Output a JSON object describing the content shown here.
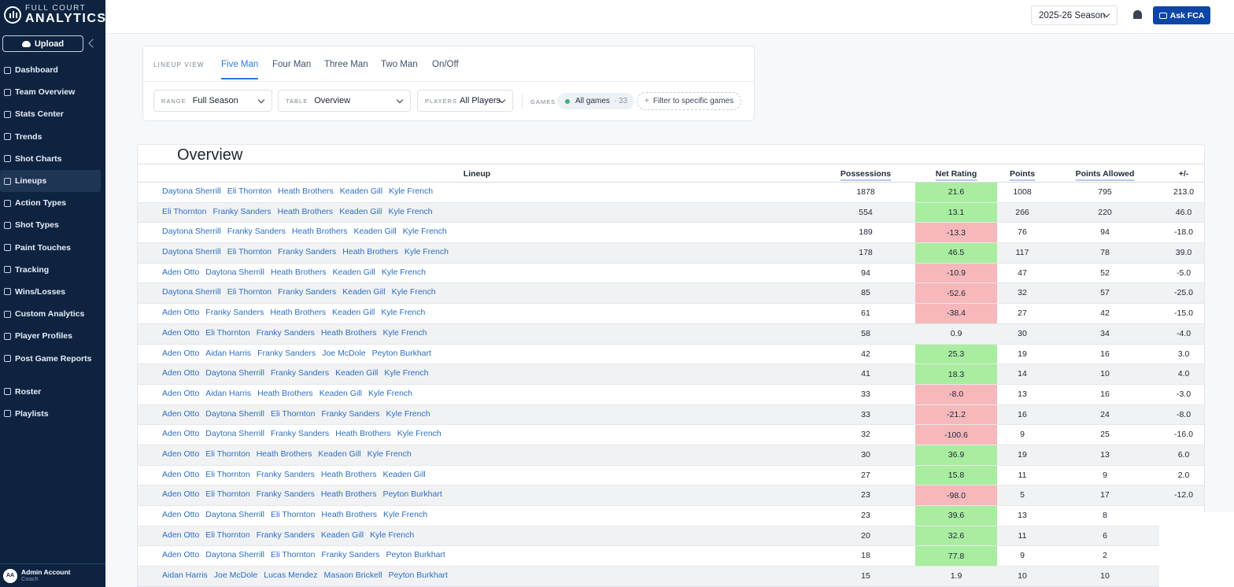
{
  "brand": {
    "top": "FULL COURT",
    "bottom": "ANALYTICS"
  },
  "sidebar": {
    "upload_label": "Upload",
    "items": [
      {
        "label": "Dashboard",
        "icon": "dashboard-icon"
      },
      {
        "label": "Team Overview",
        "icon": "team-icon"
      },
      {
        "label": "Stats Center",
        "icon": "stats-icon"
      },
      {
        "label": "Trends",
        "icon": "trend-icon"
      },
      {
        "label": "Shot Charts",
        "icon": "target-icon"
      },
      {
        "label": "Lineups",
        "icon": "table-icon",
        "active": true
      },
      {
        "label": "Action Types",
        "icon": "run-icon"
      },
      {
        "label": "Shot Types",
        "icon": "basketball-icon"
      },
      {
        "label": "Paint Touches",
        "icon": "paint-icon"
      },
      {
        "label": "Tracking",
        "icon": "chevron-up-icon"
      },
      {
        "label": "Wins/Losses",
        "icon": "wins-icon"
      },
      {
        "label": "Custom Analytics",
        "icon": "tag-icon"
      },
      {
        "label": "Player Profiles",
        "icon": "person-icon"
      },
      {
        "label": "Post Game Reports",
        "icon": "clipboard-icon"
      },
      {
        "label": "Roster",
        "icon": "roster-icon"
      },
      {
        "label": "Playlists",
        "icon": "playlist-icon"
      }
    ],
    "admin": {
      "initials": "AA",
      "name": "Admin Account",
      "role": "Coach"
    }
  },
  "topbar": {
    "season": "2025-26 Season",
    "ask_label": "Ask FCA"
  },
  "lineup_view": {
    "label": "LINEUP VIEW",
    "tabs": [
      "Five Man",
      "Four Man",
      "Three Man",
      "Two Man",
      "On/Off"
    ],
    "active_tab": "Five Man",
    "filters": {
      "range_label": "RANGE",
      "range_value": "Full Season",
      "table_label": "TABLE",
      "table_value": "Overview",
      "players_label": "PLAYERS",
      "players_value": "All Players",
      "games_label": "GAMES",
      "games_value": "All games",
      "games_count": "· 33",
      "filter_games": "Filter to specific games"
    }
  },
  "table": {
    "title": "Overview",
    "headers": {
      "lineup": "Lineup",
      "possessions": "Possessions",
      "net_rating": "Net Rating",
      "points": "Points",
      "points_allowed": "Points Allowed",
      "plus_minus": "+/-"
    },
    "colors": {
      "positive": "#a9eea0",
      "negative": "#f7b8bc",
      "neutral": "transparent"
    },
    "rows": [
      {
        "players": [
          "Daytona Sherrill",
          "Eli Thornton",
          "Heath Brothers",
          "Keaden Gill",
          "Kyle French"
        ],
        "possessions": "1878",
        "net_rating": "21.6",
        "points": "1008",
        "points_allowed": "795",
        "plus_minus": "213.0",
        "tone": "positive"
      },
      {
        "players": [
          "Eli Thornton",
          "Franky Sanders",
          "Heath Brothers",
          "Keaden Gill",
          "Kyle French"
        ],
        "possessions": "554",
        "net_rating": "13.1",
        "points": "266",
        "points_allowed": "220",
        "plus_minus": "46.0",
        "tone": "positive"
      },
      {
        "players": [
          "Daytona Sherrill",
          "Franky Sanders",
          "Heath Brothers",
          "Keaden Gill",
          "Kyle French"
        ],
        "possessions": "189",
        "net_rating": "-13.3",
        "points": "76",
        "points_allowed": "94",
        "plus_minus": "-18.0",
        "tone": "negative"
      },
      {
        "players": [
          "Daytona Sherrill",
          "Eli Thornton",
          "Franky Sanders",
          "Heath Brothers",
          "Kyle French"
        ],
        "possessions": "178",
        "net_rating": "46.5",
        "points": "117",
        "points_allowed": "78",
        "plus_minus": "39.0",
        "tone": "positive"
      },
      {
        "players": [
          "Aden Otto",
          "Daytona Sherrill",
          "Heath Brothers",
          "Keaden Gill",
          "Kyle French"
        ],
        "possessions": "94",
        "net_rating": "-10.9",
        "points": "47",
        "points_allowed": "52",
        "plus_minus": "-5.0",
        "tone": "negative"
      },
      {
        "players": [
          "Daytona Sherrill",
          "Eli Thornton",
          "Franky Sanders",
          "Keaden Gill",
          "Kyle French"
        ],
        "possessions": "85",
        "net_rating": "-52.6",
        "points": "32",
        "points_allowed": "57",
        "plus_minus": "-25.0",
        "tone": "negative"
      },
      {
        "players": [
          "Aden Otto",
          "Franky Sanders",
          "Heath Brothers",
          "Keaden Gill",
          "Kyle French"
        ],
        "possessions": "61",
        "net_rating": "-38.4",
        "points": "27",
        "points_allowed": "42",
        "plus_minus": "-15.0",
        "tone": "negative"
      },
      {
        "players": [
          "Aden Otto",
          "Eli Thornton",
          "Franky Sanders",
          "Heath Brothers",
          "Kyle French"
        ],
        "possessions": "58",
        "net_rating": "0.9",
        "points": "30",
        "points_allowed": "34",
        "plus_minus": "-4.0",
        "tone": "neutral"
      },
      {
        "players": [
          "Aden Otto",
          "Aidan Harris",
          "Franky Sanders",
          "Joe McDole",
          "Peyton Burkhart"
        ],
        "possessions": "42",
        "net_rating": "25.3",
        "points": "19",
        "points_allowed": "16",
        "plus_minus": "3.0",
        "tone": "positive"
      },
      {
        "players": [
          "Aden Otto",
          "Daytona Sherrill",
          "Franky Sanders",
          "Keaden Gill",
          "Kyle French"
        ],
        "possessions": "41",
        "net_rating": "18.3",
        "points": "14",
        "points_allowed": "10",
        "plus_minus": "4.0",
        "tone": "positive"
      },
      {
        "players": [
          "Aden Otto",
          "Aidan Harris",
          "Heath Brothers",
          "Keaden Gill",
          "Kyle French"
        ],
        "possessions": "33",
        "net_rating": "-8.0",
        "points": "13",
        "points_allowed": "16",
        "plus_minus": "-3.0",
        "tone": "negative"
      },
      {
        "players": [
          "Aden Otto",
          "Daytona Sherrill",
          "Eli Thornton",
          "Franky Sanders",
          "Kyle French"
        ],
        "possessions": "33",
        "net_rating": "-21.2",
        "points": "16",
        "points_allowed": "24",
        "plus_minus": "-8.0",
        "tone": "negative"
      },
      {
        "players": [
          "Aden Otto",
          "Daytona Sherrill",
          "Franky Sanders",
          "Heath Brothers",
          "Kyle French"
        ],
        "possessions": "32",
        "net_rating": "-100.6",
        "points": "9",
        "points_allowed": "25",
        "plus_minus": "-16.0",
        "tone": "negative"
      },
      {
        "players": [
          "Aden Otto",
          "Eli Thornton",
          "Heath Brothers",
          "Keaden Gill",
          "Kyle French"
        ],
        "possessions": "30",
        "net_rating": "36.9",
        "points": "19",
        "points_allowed": "13",
        "plus_minus": "6.0",
        "tone": "positive"
      },
      {
        "players": [
          "Aden Otto",
          "Eli Thornton",
          "Franky Sanders",
          "Heath Brothers",
          "Keaden Gill"
        ],
        "possessions": "27",
        "net_rating": "15.8",
        "points": "11",
        "points_allowed": "9",
        "plus_minus": "2.0",
        "tone": "positive"
      },
      {
        "players": [
          "Aden Otto",
          "Eli Thornton",
          "Franky Sanders",
          "Heath Brothers",
          "Peyton Burkhart"
        ],
        "possessions": "23",
        "net_rating": "-98.0",
        "points": "5",
        "points_allowed": "17",
        "plus_minus": "-12.0",
        "tone": "negative"
      },
      {
        "players": [
          "Aden Otto",
          "Daytona Sherrill",
          "Eli Thornton",
          "Heath Brothers",
          "Kyle French"
        ],
        "possessions": "23",
        "net_rating": "39.6",
        "points": "13",
        "points_allowed": "8",
        "plus_minus": "",
        "tone": "positive"
      },
      {
        "players": [
          "Aden Otto",
          "Eli Thornton",
          "Franky Sanders",
          "Keaden Gill",
          "Kyle French"
        ],
        "possessions": "20",
        "net_rating": "32.6",
        "points": "11",
        "points_allowed": "6",
        "plus_minus": "",
        "tone": "positive"
      },
      {
        "players": [
          "Aden Otto",
          "Daytona Sherrill",
          "Eli Thornton",
          "Franky Sanders",
          "Peyton Burkhart"
        ],
        "possessions": "18",
        "net_rating": "77.8",
        "points": "9",
        "points_allowed": "2",
        "plus_minus": "",
        "tone": "positive"
      },
      {
        "players": [
          "Aidan Harris",
          "Joe McDole",
          "Lucas Mendez",
          "Masaon Brickell",
          "Peyton Burkhart"
        ],
        "possessions": "15",
        "net_rating": "1.9",
        "points": "10",
        "points_allowed": "10",
        "plus_minus": "",
        "tone": "neutral"
      }
    ]
  }
}
